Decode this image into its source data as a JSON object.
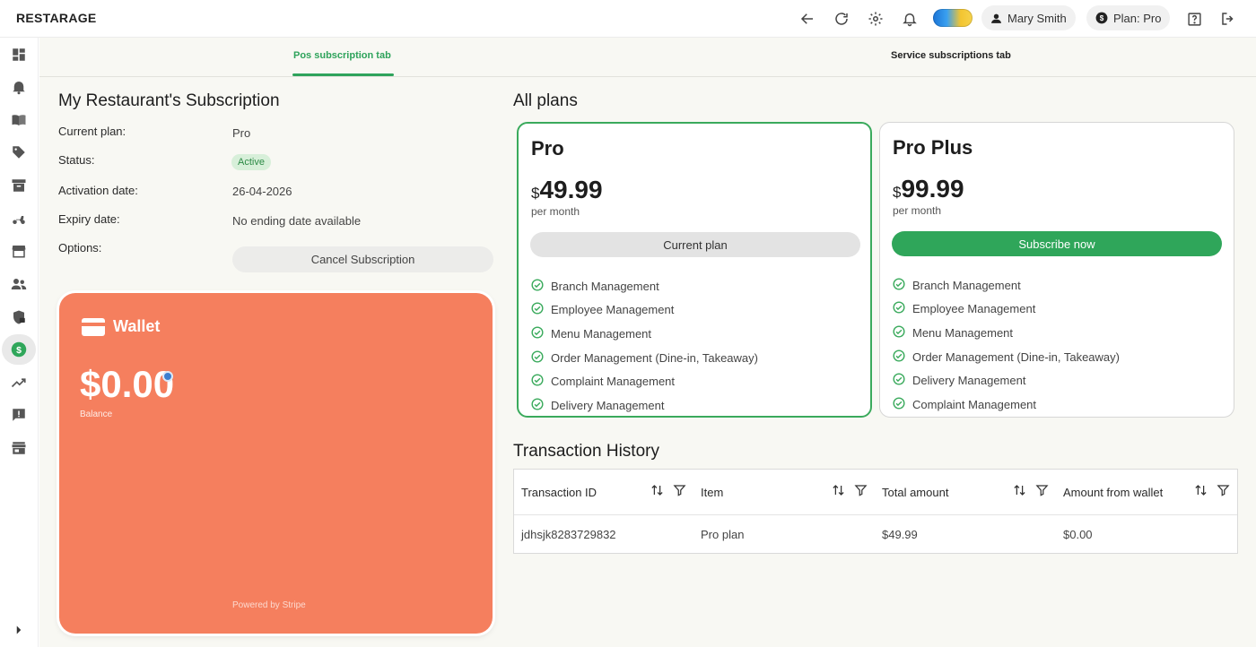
{
  "header": {
    "logo": "RESTARAGE",
    "user_name": "Mary Smith",
    "plan_label": "Plan: Pro"
  },
  "tabs": [
    {
      "label": "Pos subscription tab",
      "active": true
    },
    {
      "label": "Service subscriptions tab",
      "active": false
    }
  ],
  "subscription": {
    "title": "My Restaurant's Subscription",
    "current_plan_label": "Current plan:",
    "current_plan_value": "Pro",
    "status_label": "Status:",
    "status_value": "Active",
    "activation_label": "Activation date:",
    "activation_value": "26-04-2026",
    "expiry_label": "Expiry date:",
    "expiry_value": "No ending date available",
    "options_label": "Options:",
    "cancel_button": "Cancel Subscription"
  },
  "wallet": {
    "title": "Wallet",
    "amount": "$0.00",
    "balance_label": "Balance",
    "powered_by": "Powered by Stripe",
    "color": "#f57f5e"
  },
  "plans": {
    "title": "All plans",
    "items": [
      {
        "name": "Pro",
        "currency": "$",
        "price": "49.99",
        "period": "per month",
        "button": "Current plan",
        "features": [
          "Branch Management",
          "Employee Management",
          "Menu Management",
          "Order Management (Dine-in, Takeaway)",
          "Complaint Management",
          "Delivery Management"
        ]
      },
      {
        "name": "Pro Plus",
        "currency": "$",
        "price": "99.99",
        "period": "per month",
        "button": "Subscribe now",
        "features": [
          "Branch Management",
          "Employee Management",
          "Menu Management",
          "Order Management (Dine-in, Takeaway)",
          "Delivery Management",
          "Complaint Management"
        ]
      }
    ]
  },
  "transactions": {
    "title": "Transaction History",
    "columns": [
      "Transaction ID",
      "Item",
      "Total amount",
      "Amount from wallet"
    ],
    "rows": [
      [
        "jdhsjk8283729832",
        "Pro plan",
        "$49.99",
        "$0.00"
      ]
    ]
  },
  "colors": {
    "accent_green": "#2fa65a",
    "active_tab": "#2ea35b"
  }
}
